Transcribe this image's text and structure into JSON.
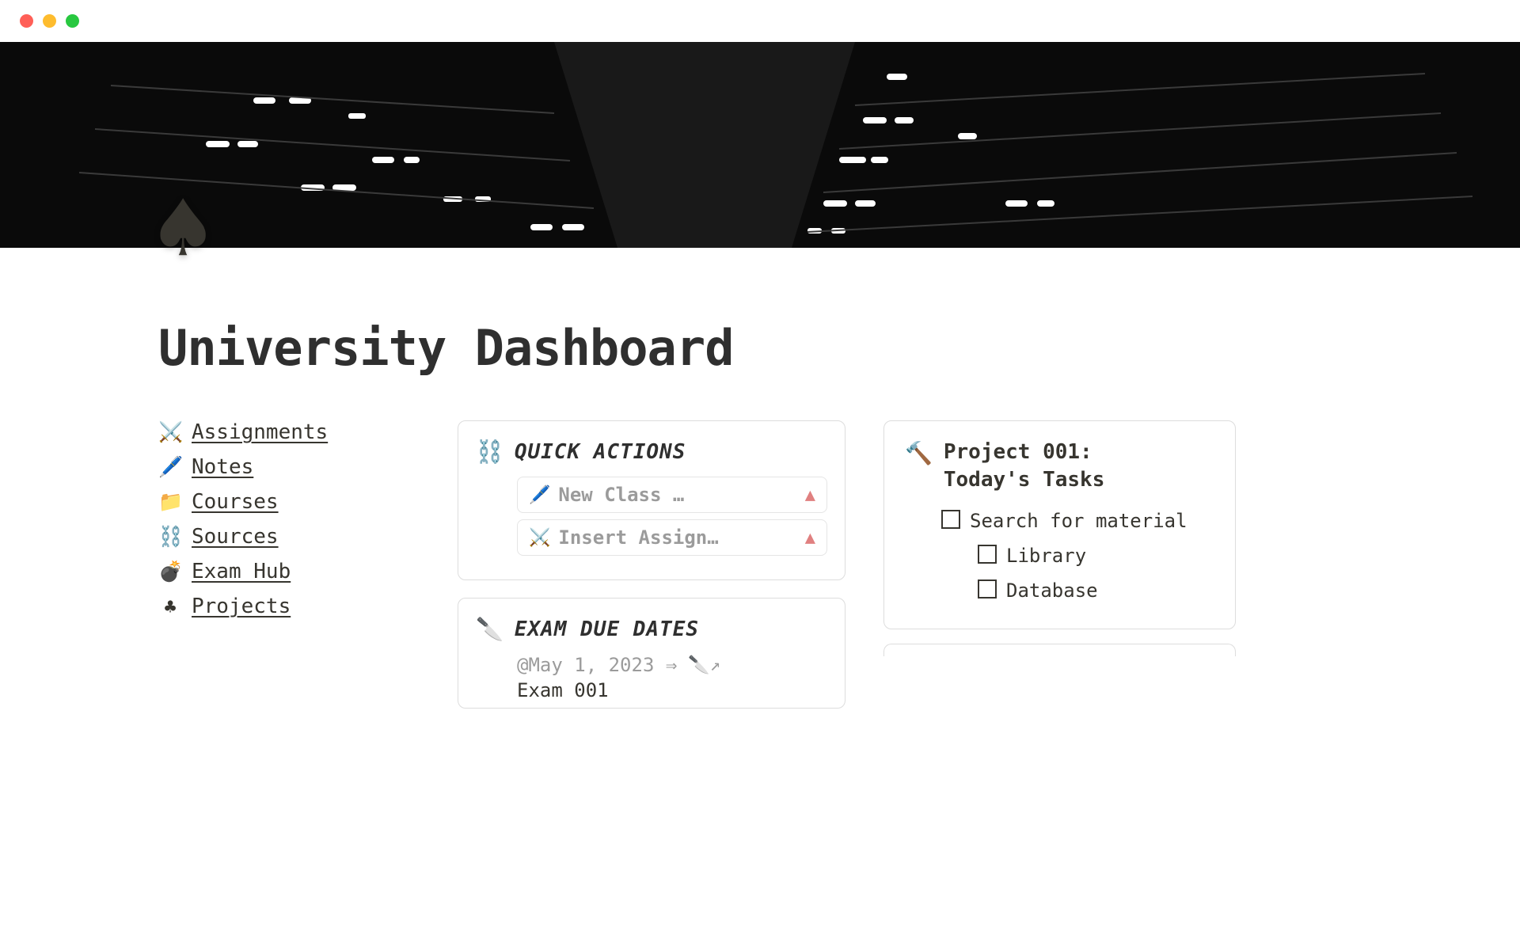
{
  "page": {
    "icon": "♠",
    "title": "University Dashboard"
  },
  "nav": [
    {
      "emoji": "⚔️",
      "label": "Assignments"
    },
    {
      "emoji": "🖊️",
      "label": "Notes"
    },
    {
      "emoji": "📁",
      "label": "Courses"
    },
    {
      "emoji": "⛓️",
      "label": "Sources"
    },
    {
      "emoji": "💣",
      "label": "Exam Hub"
    },
    {
      "emoji": "♣",
      "label": "Projects"
    }
  ],
  "quick_actions": {
    "icon": "⛓️",
    "title": "QUICK ACTIONS",
    "rows": [
      {
        "icon": "🖊️",
        "text": "New Class …"
      },
      {
        "icon": "⚔️",
        "text": "Insert Assign…"
      }
    ]
  },
  "exam_due": {
    "icon": "🔪",
    "title": "EXAM DUE DATES",
    "date_prefix": "@May 1, 2023 ⇒",
    "date_emoji": "🔪↗",
    "name": "Exam 001"
  },
  "project": {
    "icon": "🔨",
    "title_line1": "Project 001:",
    "title_line2": "Today's Tasks",
    "tasks": {
      "main": "Search for material",
      "sub1": "Library",
      "sub2": "Database"
    }
  }
}
